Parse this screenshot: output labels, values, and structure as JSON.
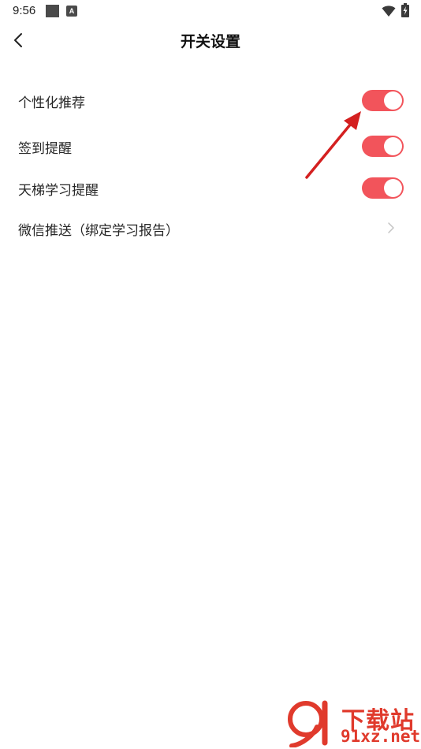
{
  "status_bar": {
    "time": "9:56",
    "notif_a_label": "A"
  },
  "header": {
    "title": "开关设置",
    "back_icon": "chevron-left-icon"
  },
  "settings": [
    {
      "label": "个性化推荐",
      "type": "toggle",
      "on": true
    },
    {
      "label": "签到提醒",
      "type": "toggle",
      "on": true
    },
    {
      "label": "天梯学习提醒",
      "type": "toggle",
      "on": true
    },
    {
      "label": "微信推送（绑定学习报告）",
      "type": "link"
    }
  ],
  "colors": {
    "toggle_on": "#f2545b",
    "annotation_arrow": "#d42020",
    "watermark": "#e03a2c"
  },
  "watermark": {
    "line1": "下载站",
    "line2": "91xz.net"
  }
}
